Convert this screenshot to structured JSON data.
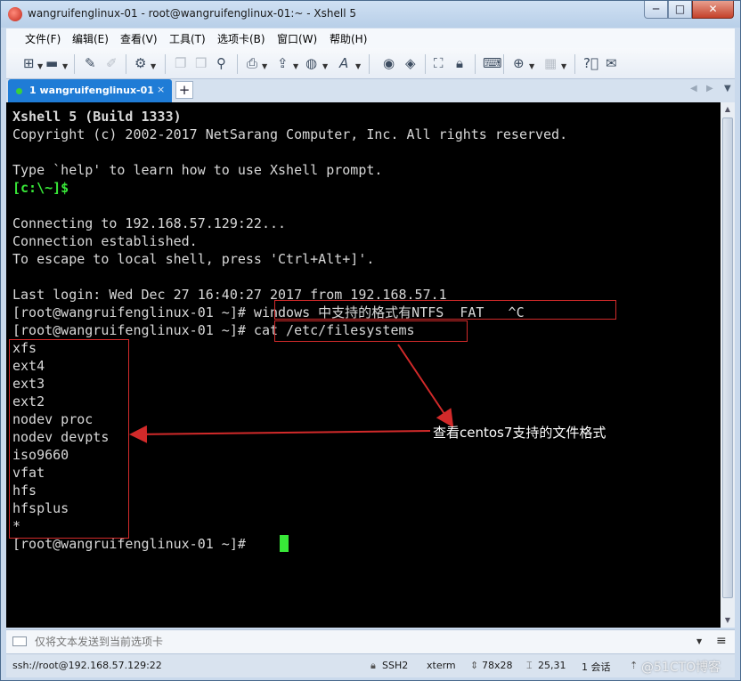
{
  "window": {
    "title": "wangruifenglinux-01 - root@wangruifenglinux-01:~ - Xshell 5",
    "minimize_glyph": "─",
    "maximize_glyph": "□",
    "close_glyph": "✕"
  },
  "menu": [
    "文件(F)",
    "编辑(E)",
    "查看(V)",
    "工具(T)",
    "选项卡(B)",
    "窗口(W)",
    "帮助(H)"
  ],
  "tabs": [
    {
      "label": "1 wangruifenglinux-01",
      "close": "×",
      "status_color": "#3ad13a"
    }
  ],
  "tab_controls": {
    "add": "+",
    "prev": "◀",
    "next": "▶",
    "menu": "▼"
  },
  "terminal": {
    "lines": [
      "Xshell 5 (Build 1333)",
      "Copyright (c) 2002-2017 NetSarang Computer, Inc. All rights reserved.",
      "",
      "Type `help' to learn how to use Xshell prompt.",
      "[c:\\~]$",
      "",
      "Connecting to 192.168.57.129:22...",
      "Connection established.",
      "To escape to local shell, press 'Ctrl+Alt+]'.",
      "",
      "Last login: Wed Dec 27 16:40:27 2017 from 192.168.57.1",
      "[root@wangruifenglinux-01 ~]# windows 中支持的格式有NTFS  FAT   ^C",
      "[root@wangruifenglinux-01 ~]# cat /etc/filesystems",
      "xfs",
      "ext4",
      "ext3",
      "ext2",
      "nodev proc",
      "nodev devpts",
      "iso9660",
      "vfat",
      "hfs",
      "hfsplus",
      "*",
      "[root@wangruifenglinux-01 ~]# "
    ],
    "cursor_color": "#38e838"
  },
  "annotation": {
    "text": "查看centos7支持的文件格式",
    "color": "#d22a2a"
  },
  "compose": {
    "placeholder": "仅将文本发送到当前选项卡"
  },
  "status": {
    "connection": "ssh://root@192.168.57.129:22",
    "protocol": "SSH2",
    "terminal_type": "xterm",
    "size": "78x28",
    "cursor_pos": "25,31",
    "sessions": "1 会话"
  },
  "watermark": "@51CTO博客"
}
